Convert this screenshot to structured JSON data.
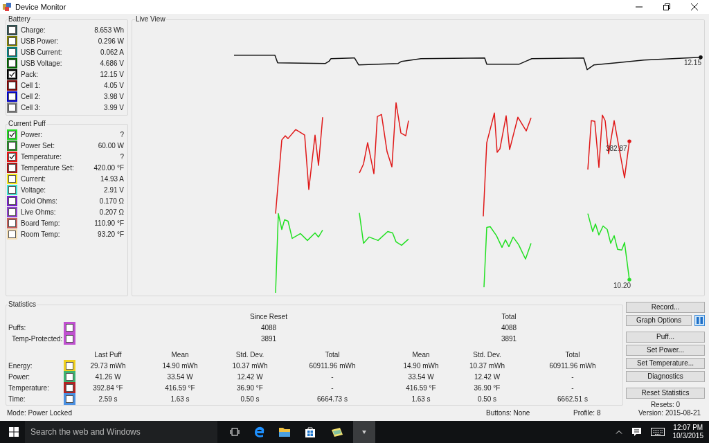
{
  "window": {
    "title": "Device Monitor"
  },
  "battery": {
    "title": "Battery",
    "items": [
      {
        "label": "Charge:",
        "value": "8.653 Wh",
        "checked": false,
        "color": "#2f4f4f"
      },
      {
        "label": "USB Power:",
        "value": "0.296 W",
        "checked": false,
        "color": "#808000"
      },
      {
        "label": "USB Current:",
        "value": "0.062 A",
        "checked": false,
        "color": "#008080"
      },
      {
        "label": "USB Voltage:",
        "value": "4.686 V",
        "checked": false,
        "color": "#006400"
      },
      {
        "label": "Pack:",
        "value": "12.15 V",
        "checked": true,
        "color": "#000000"
      },
      {
        "label": "Cell 1:",
        "value": "4.05 V",
        "checked": false,
        "color": "#800000"
      },
      {
        "label": "Cell 2:",
        "value": "3.98 V",
        "checked": false,
        "color": "#0000cd"
      },
      {
        "label": "Cell 3:",
        "value": "3.99 V",
        "checked": false,
        "color": "#808080"
      }
    ]
  },
  "current_puff": {
    "title": "Current Puff",
    "items": [
      {
        "label": "Power:",
        "value": "?",
        "checked": true,
        "color": "#22e022"
      },
      {
        "label": "Power Set:",
        "value": "60.00 W",
        "checked": false,
        "color": "#228b22"
      },
      {
        "label": "Temperature:",
        "value": "?",
        "checked": true,
        "color": "#ee1111"
      },
      {
        "label": "Temperature Set:",
        "value": "420.00 °F",
        "checked": false,
        "color": "#b01515"
      },
      {
        "label": "Current:",
        "value": "14.93 A",
        "checked": false,
        "color": "#f5e81a"
      },
      {
        "label": "Voltage:",
        "value": "2.91 V",
        "checked": false,
        "color": "#40e0d0"
      },
      {
        "label": "Cold Ohms:",
        "value": "0.170 Ω",
        "checked": false,
        "color": "#7a1fd0"
      },
      {
        "label": "Live Ohms:",
        "value": "0.207 Ω",
        "checked": false,
        "color": "#9040d0"
      },
      {
        "label": "Board Temp:",
        "value": "110.90 °F",
        "checked": false,
        "color": "#c86058"
      },
      {
        "label": "Room Temp:",
        "value": "93.20 °F",
        "checked": false,
        "color": "#f5deb3"
      }
    ]
  },
  "live_view": {
    "title": "Live View",
    "readings": [
      {
        "kind": "voltage",
        "text": "12.15"
      },
      {
        "kind": "temperature",
        "text": "382.87"
      },
      {
        "kind": "power",
        "text": "10.20"
      }
    ]
  },
  "statistics": {
    "title": "Statistics",
    "count_headers": [
      "Since Reset",
      "Total"
    ],
    "counts": [
      {
        "label": "Puffs:",
        "color": "#c050d0",
        "checked": false,
        "since_reset": "4088",
        "total": "4088"
      },
      {
        "label": "Temp-Protected:",
        "color": "#c050d0",
        "checked": false,
        "since_reset": "3891",
        "total": "3891"
      }
    ],
    "columns": [
      "Last Puff",
      "Mean",
      "Std. Dev.",
      "Total",
      "Mean",
      "Std. Dev.",
      "Total"
    ],
    "rows": [
      {
        "label": "Energy:",
        "color": "#f0d020",
        "checked": false,
        "cells": [
          "29.73 mWh",
          "14.90 mWh",
          "10.37 mWh",
          "60911.96 mWh",
          "14.90 mWh",
          "10.37 mWh",
          "60911.96 mWh"
        ]
      },
      {
        "label": "Power:",
        "color": "#3cb371",
        "checked": false,
        "cells": [
          "41.26 W",
          "33.54 W",
          "12.42 W",
          "-",
          "33.54 W",
          "12.42 W",
          "-"
        ]
      },
      {
        "label": "Temperature:",
        "color": "#b22222",
        "checked": false,
        "cells": [
          "392.84 °F",
          "416.59 °F",
          "36.90 °F",
          "-",
          "416.59 °F",
          "36.90 °F",
          "-"
        ]
      },
      {
        "label": "Time:",
        "color": "#4a90e2",
        "checked": false,
        "cells": [
          "2.59 s",
          "1.63 s",
          "0.50 s",
          "6664.73 s",
          "1.63 s",
          "0.50 s",
          "6662.51 s"
        ]
      }
    ]
  },
  "button_groups": [
    [
      {
        "label": "Record...",
        "kind": "plain"
      },
      {
        "label": "Graph Options",
        "kind": "with_toggle"
      }
    ],
    [
      {
        "label": "Puff...",
        "kind": "plain"
      },
      {
        "label": "Set Power...",
        "kind": "plain"
      },
      {
        "label": "Set Temperature...",
        "kind": "plain"
      },
      {
        "label": "Diagnostics",
        "kind": "plain"
      }
    ],
    [
      {
        "label": "Reset Statistics",
        "kind": "plain"
      }
    ]
  ],
  "resets": "Resets: 0",
  "status_bar": {
    "mode": "Mode: Power Locked",
    "buttons": "Buttons: None",
    "profile": "Profile: 8",
    "version": "Version: 2015-08-21"
  },
  "taskbar": {
    "search": {
      "placeholder": "Search the web and Windows"
    },
    "time": "12:07 PM",
    "date": "10/3/2015"
  }
}
